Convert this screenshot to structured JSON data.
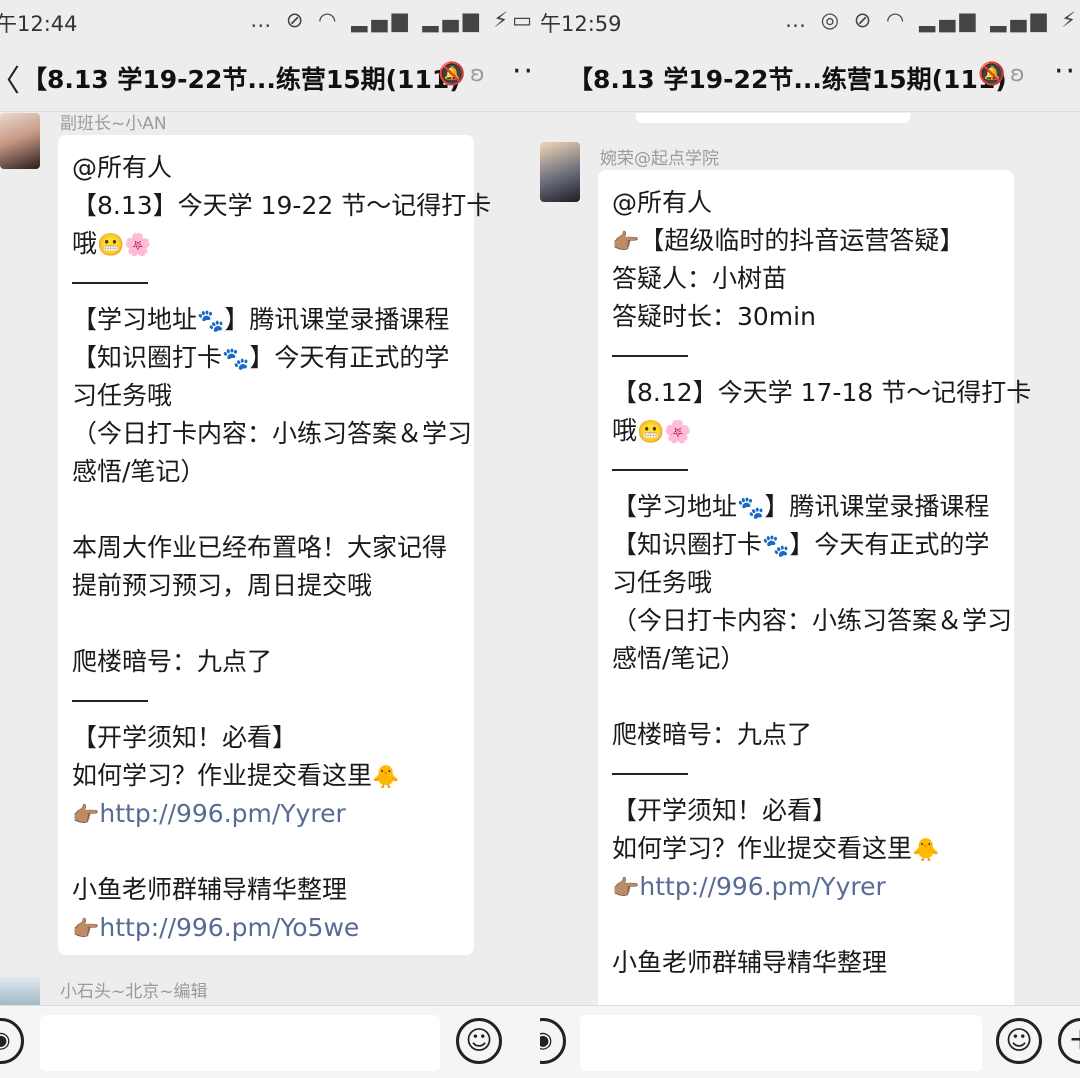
{
  "left": {
    "status": {
      "time": "午12:44",
      "icons": "… ⊘ ◠ ▂▄▆ ▂▄▆ ⚡▭"
    },
    "header": {
      "back": "〈",
      "title": "【8.13 学19-22节...练营15期(111)",
      "more": "··"
    },
    "prev_message": {
      "sender": "副班长~小AN"
    },
    "message": {
      "lines": [
        "@所有人",
        "【8.13】今天学 19-22 节～记得打卡",
        "哦",
        "",
        "【学习地址",
        "】腾讯课堂录播课程",
        "【知识圈打卡",
        "】今天有正式的学",
        "习任务哦",
        "（今日打卡内容：小练习答案＆学习",
        "感悟/笔记）",
        "本周大作业已经布置咯！大家记得",
        "提前预习预习，周日提交哦",
        "爬楼暗号：九点了",
        "【开学须知！必看】",
        "如何学习？作业提交看这里",
        "http://996.pm/Yyrer",
        "小鱼老师群辅导精华整理",
        "http://996.pm/Yo5we"
      ],
      "emoji_grin": "😬",
      "emoji_flower": "🌸",
      "emoji_paw": "🐾",
      "emoji_chick": "🐥",
      "emoji_point": "👉🏽"
    },
    "next_message": {
      "sender": "小石头~北京~编辑"
    },
    "inputbar": {
      "voice": "◉",
      "emoji": "☺"
    }
  },
  "right": {
    "status": {
      "time": "午12:59",
      "icons": "… ◎ ⊘ ◠ ▂▄▆ ▂▄▆ ⚡"
    },
    "header": {
      "back": "",
      "title": "【8.13 学19-22节...练营15期(111)",
      "more": "··"
    },
    "message": {
      "sender": "婉荣@起点学院",
      "lines": [
        "@所有人",
        "【超级临时的抖音运营答疑】",
        "答疑人：小树苗",
        "答疑时长：30min",
        "【8.12】今天学 17-18 节～记得打卡",
        "哦",
        "【学习地址",
        "】腾讯课堂录播课程",
        "【知识圈打卡",
        "】今天有正式的学",
        "习任务哦",
        "（今日打卡内容：小练习答案＆学习",
        "感悟/笔记）",
        "爬楼暗号：九点了",
        "【开学须知！必看】",
        "如何学习？作业提交看这里",
        "http://996.pm/Yyrer",
        "小鱼老师群辅导精华整理"
      ],
      "emoji_grin": "😬",
      "emoji_flower": "🌸",
      "emoji_paw": "🐾",
      "emoji_chick": "🐥",
      "emoji_point": "👉🏽"
    },
    "inputbar": {
      "voice": "◉",
      "emoji": "☺",
      "plus": "+"
    }
  },
  "colors": {
    "background": "#ededed",
    "bubble": "#ffffff",
    "link": "#576b95",
    "sender": "#9a9a9a"
  }
}
